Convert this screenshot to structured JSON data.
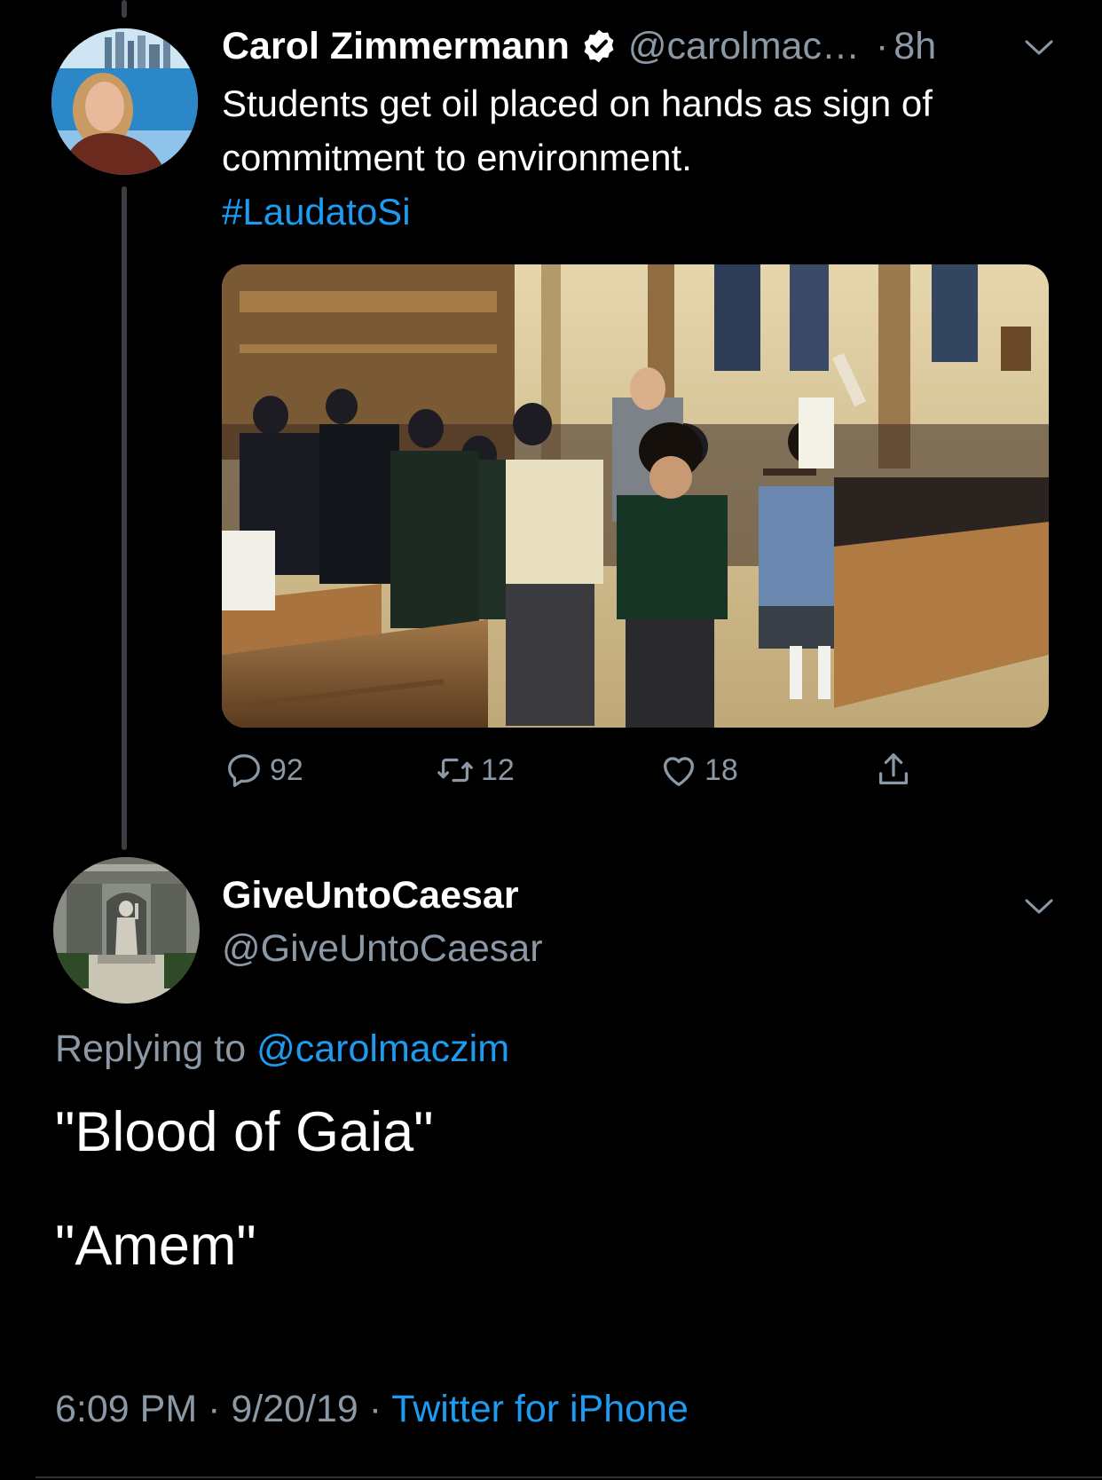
{
  "colors": {
    "background": "#000000",
    "primary_text": "#ffffff",
    "secondary_text": "#8b98a5",
    "link": "#1d9bf0",
    "thread_line": "#3a3d41"
  },
  "tweet": {
    "author_name": "Carol Zimmermann",
    "verified_icon": "verified-badge-icon",
    "handle": "@carolmac…",
    "separator": "·",
    "time": "8h",
    "text": "Students get oil placed on hands as sign of commitment to environment.",
    "hashtag": "#LaudatoSi",
    "image_icon": "photo-church-students",
    "actions": {
      "reply_count": "92",
      "retweet_count": "12",
      "like_count": "18"
    }
  },
  "reply": {
    "author_name": "GiveUntoCaesar",
    "handle": "@GiveUntoCaesar",
    "replying_prefix": "Replying to",
    "replying_mention": "@carolmaczim",
    "line1": "\"Blood of Gaia\"",
    "line2": "\"Amem\"",
    "time": "6:09 PM",
    "sep1": "·",
    "date": "9/20/19",
    "sep2": "·",
    "client": "Twitter for iPhone"
  }
}
